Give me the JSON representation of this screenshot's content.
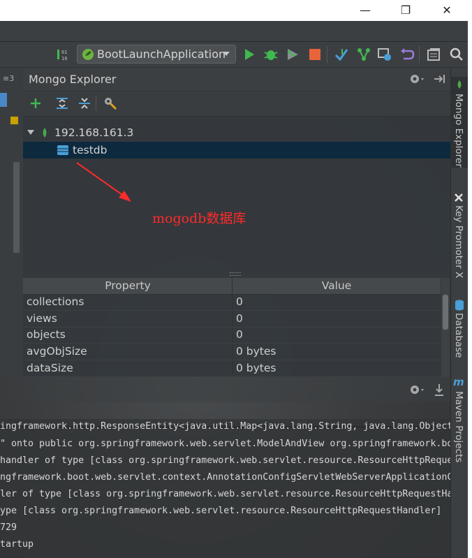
{
  "window": {
    "minimize": "—",
    "restore": "❐",
    "close": "✕"
  },
  "toolbar": {
    "run_config": "BootLaunchApplication",
    "icons": [
      "build-icon",
      "run-icon",
      "debug-icon",
      "coverage-icon",
      "stop-icon",
      "git-update-icon",
      "git-commit-icon",
      "history-icon",
      "revert-icon",
      "structure-icon",
      "search-icon"
    ]
  },
  "left_strip": {
    "tab_label": "≡3"
  },
  "mongo_explorer": {
    "title": "Mongo Explorer",
    "header_icons": [
      "gear-icon",
      "hide-icon"
    ],
    "tool_icons": [
      "add-icon",
      "expand-all-icon",
      "collapse-all-icon",
      "settings-icon"
    ],
    "tree": {
      "server": "192.168.161.3",
      "database": "testdb"
    }
  },
  "annotation": "mogodb数据库",
  "properties": {
    "headers": {
      "property": "Property",
      "value": "Value"
    },
    "rows": [
      {
        "key": "collections",
        "value": "0"
      },
      {
        "key": "views",
        "value": "0"
      },
      {
        "key": "objects",
        "value": "0"
      },
      {
        "key": "avgObjSize",
        "value": "0 bytes"
      },
      {
        "key": "dataSize",
        "value": "0 bytes"
      }
    ]
  },
  "right_tabs": [
    {
      "label": "Mongo Explorer",
      "icon": "mongo-leaf-icon"
    },
    {
      "label": "Key Promoter X",
      "icon": "key-promoter-icon"
    },
    {
      "label": "Database",
      "icon": "database-icon"
    },
    {
      "label": "Maven Projects",
      "icon": "maven-icon"
    }
  ],
  "console": {
    "lines": [
      "ingframework.http.ResponseEntity<java.util.Map<java.lang.String, java.lang.Object",
      "\" onto public org.springframework.web.servlet.ModelAndView org.springframework.bo",
      "handler of type [class org.springframework.web.servlet.resource.ResourceHttpReque",
      "ngframework.boot.web.servlet.context.AnnotationConfigServletWebServerApplicationC",
      "ler of type [class org.springframework.web.servlet.resource.ResourceHttpRequestHa",
      "ype [class org.springframework.web.servlet.resource.ResourceHttpRequestHandler]",
      "729",
      "tartup"
    ]
  },
  "colors": {
    "annotation": "#ff2a2a",
    "selection": "#0d293e",
    "run_green": "#3fb950",
    "stop_orange": "#e8643a",
    "mongo_green": "#4ca64c",
    "database_blue": "#4a9fd8"
  }
}
